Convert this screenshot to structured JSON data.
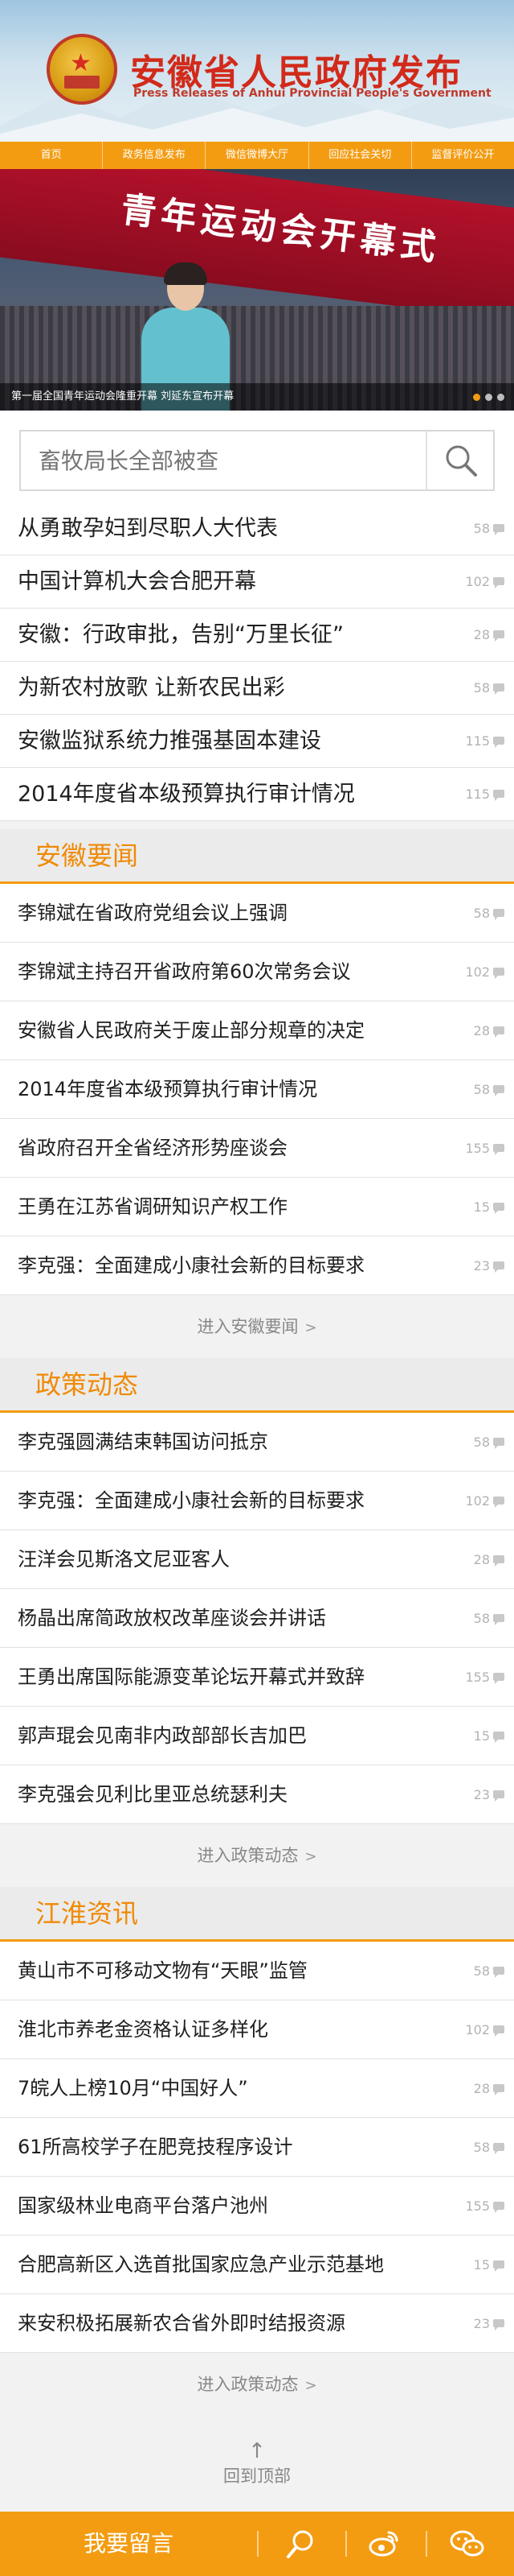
{
  "header": {
    "title": "安徽省人民政府发布",
    "subtitle": "Press Releases of Anhui Provincial People's Government"
  },
  "nav": [
    "首页",
    "政务信息发布",
    "微信微博大厅",
    "回应社会关切",
    "监督评价公开"
  ],
  "banner": {
    "slogan": "青年运动会开幕式",
    "caption": "第一届全国青年运动会隆重开幕 刘延东宣布开幕"
  },
  "search": {
    "placeholder": "畜牧局长全部被查"
  },
  "top_news": [
    {
      "title": "从勇敢孕妇到尽职人大代表",
      "count": "58"
    },
    {
      "title": "中国计算机大会合肥开幕",
      "count": "102"
    },
    {
      "title": "安徽：行政审批，告别“万里长征”",
      "count": "28"
    },
    {
      "title": "为新农村放歌  让新农民出彩",
      "count": "58"
    },
    {
      "title": "安徽监狱系统力推强基固本建设",
      "count": "115"
    },
    {
      "title": "2014年度省本级预算执行审计情况",
      "count": "115"
    }
  ],
  "sections": [
    {
      "heading": "安徽要闻",
      "more": "进入安徽要闻",
      "items": [
        {
          "title": "李锦斌在省政府党组会议上强调",
          "count": "58"
        },
        {
          "title": "李锦斌主持召开省政府第60次常务会议",
          "count": "102"
        },
        {
          "title": "安徽省人民政府关于废止部分规章的决定",
          "count": "28"
        },
        {
          "title": "2014年度省本级预算执行审计情况",
          "count": "58"
        },
        {
          "title": "省政府召开全省经济形势座谈会",
          "count": "155"
        },
        {
          "title": "王勇在江苏省调研知识产权工作",
          "count": "15"
        },
        {
          "title": "李克强：全面建成小康社会新的目标要求",
          "count": "23"
        }
      ]
    },
    {
      "heading": "政策动态",
      "more": "进入政策动态",
      "items": [
        {
          "title": "李克强圆满结束韩国访问抵京",
          "count": "58"
        },
        {
          "title": "李克强：全面建成小康社会新的目标要求",
          "count": "102"
        },
        {
          "title": "汪洋会见斯洛文尼亚客人",
          "count": "28"
        },
        {
          "title": "杨晶出席简政放权改革座谈会并讲话",
          "count": "58"
        },
        {
          "title": "王勇出席国际能源变革论坛开幕式并致辞",
          "count": "155"
        },
        {
          "title": "郭声琨会见南非内政部部长吉加巴",
          "count": "15"
        },
        {
          "title": "李克强会见利比里亚总统瑟利夫",
          "count": "23"
        }
      ]
    },
    {
      "heading": "江淮资讯",
      "more": "进入政策动态",
      "items": [
        {
          "title": "黄山市不可移动文物有“天眼”监管",
          "count": "58"
        },
        {
          "title": "淮北市养老金资格认证多样化",
          "count": "102"
        },
        {
          "title": "7皖人上榜10月“中国好人”",
          "count": "28"
        },
        {
          "title": "61所高校学子在肥竞技程序设计",
          "count": "58"
        },
        {
          "title": "国家级林业电商平台落户池州",
          "count": "155"
        },
        {
          "title": "合肥高新区入选首批国家应急产业示范基地",
          "count": "15"
        },
        {
          "title": "来安积极拓展新农合省外即时结报资源",
          "count": "23"
        }
      ]
    }
  ],
  "back_to_top": "回到顶部",
  "bottom_bar": {
    "message": "我要留言",
    "icons": [
      "search-icon",
      "weibo-icon",
      "wechat-icon"
    ]
  },
  "colors": {
    "accent": "#f39c12",
    "title_red": "#d22a1a",
    "section_text": "#f08a06"
  }
}
